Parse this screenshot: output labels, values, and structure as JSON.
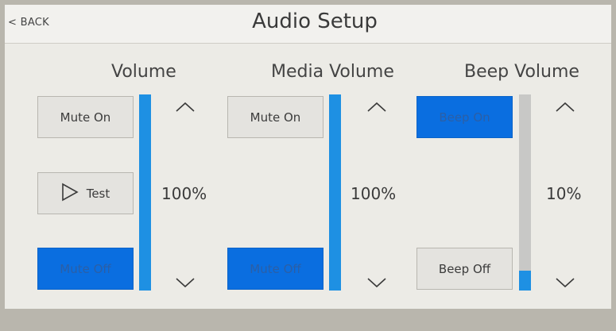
{
  "header": {
    "back_label": "< BACK",
    "title": "Audio Setup"
  },
  "columns": [
    {
      "label": "Volume",
      "level_percent": 100,
      "level_text": "100%",
      "buttons": {
        "top": "Mute On",
        "middle": "Test",
        "bottom": "Mute Off"
      },
      "active": "bottom"
    },
    {
      "label": "Media Volume",
      "level_percent": 100,
      "level_text": "100%",
      "buttons": {
        "top": "Mute On",
        "bottom": "Mute Off"
      },
      "active": "bottom"
    },
    {
      "label": "Beep Volume",
      "level_percent": 10,
      "level_text": "10%",
      "buttons": {
        "top": "Beep On",
        "bottom": "Beep Off"
      },
      "active": "top"
    }
  ],
  "colors": {
    "accent": "#0a6ee0",
    "bar_fill": "#1e90e3",
    "bar_track": "#c8c8c6"
  },
  "icons": {
    "up": "chevron-up-icon",
    "down": "chevron-down-icon",
    "play": "play-icon"
  }
}
